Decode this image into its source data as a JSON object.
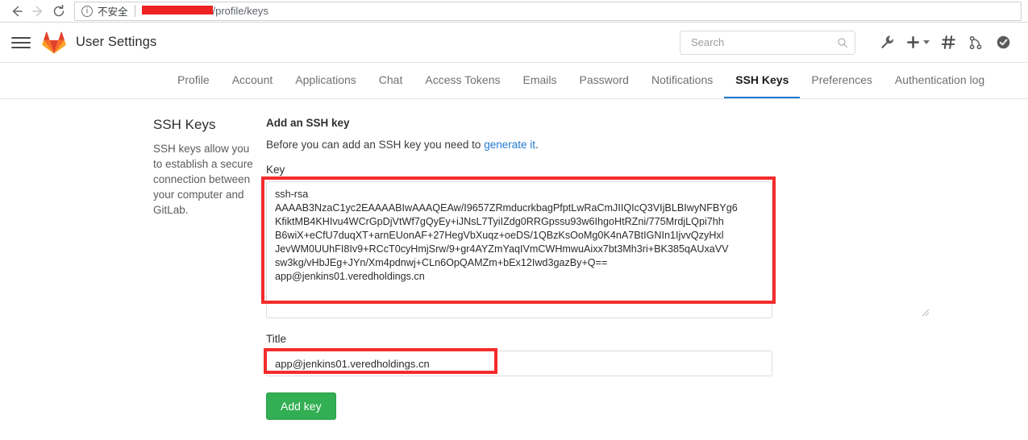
{
  "browser": {
    "back_icon": "arrow-left-icon",
    "forward_icon": "arrow-right-icon",
    "reload_icon": "reload-icon",
    "security_label": "不安全",
    "url_redacted": true,
    "url_path": "/profile/keys"
  },
  "navbar": {
    "menu_icon": "hamburger-icon",
    "logo_icon": "gitlab-logo-icon",
    "title": "User Settings",
    "search": {
      "placeholder": "Search",
      "value": "",
      "icon": "search-icon"
    },
    "icons": [
      {
        "name": "wrench-icon",
        "label": "Admin area"
      },
      {
        "name": "plus-icon",
        "label": "New..."
      },
      {
        "name": "hash-icon",
        "label": "Issues"
      },
      {
        "name": "merge-request-icon",
        "label": "Merge requests"
      },
      {
        "name": "todos-check-icon",
        "label": "Todos"
      }
    ]
  },
  "tabs": [
    {
      "label": "Profile",
      "active": false
    },
    {
      "label": "Account",
      "active": false
    },
    {
      "label": "Applications",
      "active": false
    },
    {
      "label": "Chat",
      "active": false
    },
    {
      "label": "Access Tokens",
      "active": false
    },
    {
      "label": "Emails",
      "active": false
    },
    {
      "label": "Password",
      "active": false
    },
    {
      "label": "Notifications",
      "active": false
    },
    {
      "label": "SSH Keys",
      "active": true
    },
    {
      "label": "Preferences",
      "active": false
    },
    {
      "label": "Authentication log",
      "active": false
    }
  ],
  "sidebar_info": {
    "heading": "SSH Keys",
    "description": "SSH keys allow you to establish a secure connection between your computer and GitLab."
  },
  "form": {
    "heading": "Add an SSH key",
    "subtext_before": "Before you can add an SSH key you need to ",
    "subtext_link": "generate it",
    "subtext_after": ".",
    "key_label": "Key",
    "key_value": "ssh-rsa\nAAAAB3NzaC1yc2EAAAABIwAAAQEAw/I9657ZRmducrkbagPfptLwRaCmJIIQIcQ3VIjBLBIwyNFBYg6\nKfiktMB4KHIvu4WCrGpDjVtWf7gQyEy+iJNsL7TyiIZdg0RRGpssu93w6IhgoHtRZni/775MrdjLQpi7hh\nB6wiX+eCfU7duqXT+arnEUonAF+27HegVbXuqz+oeDS/1QBzKsOoMg0K4nA7BtIGNIn1IjvvQzyHxl\nJevWM0UUhFI8Iv9+RCcT0cyHmjSrw/9+gr4AYZmYaqIVmCWHmwuAixx7bt3Mh3ri+BK385qAUxaVV\nsw3kg/vHbJEg+JYn/Xm4pdnwj+CLn6OpQAMZm+bEx12Iwd3gazBy+Q==\napp@jenkins01.veredholdings.cn",
    "key_placeholder": "",
    "title_label": "Title",
    "title_value": "app@jenkins01.veredholdings.cn",
    "title_placeholder": "",
    "submit_label": "Add key"
  },
  "annotations": {
    "highlight_color": "#f42c2c",
    "key_box_highlighted": true,
    "title_box_highlighted": true
  },
  "colors": {
    "accent_blue": "#1f78d1",
    "button_green": "#31af52",
    "link_blue": "#1f78d1",
    "gitlab_orange": "#e24329"
  }
}
